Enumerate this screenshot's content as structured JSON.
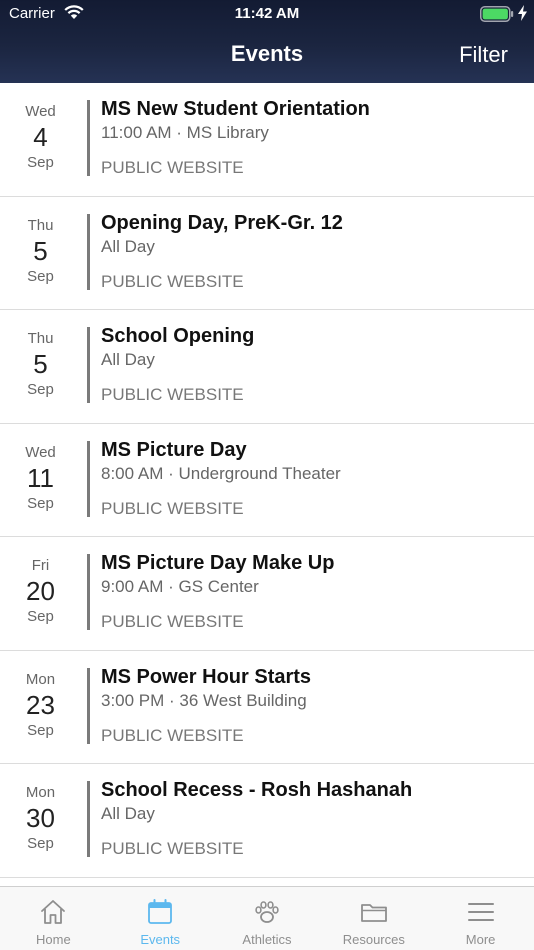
{
  "status_bar": {
    "carrier": "Carrier",
    "time": "11:42 AM"
  },
  "nav": {
    "title": "Events",
    "filter_label": "Filter"
  },
  "events": [
    {
      "dow": "Wed",
      "day": "4",
      "month": "Sep",
      "title": "MS New Student Orientation",
      "time": "11:00 AM · MS Library",
      "source": "PUBLIC WEBSITE"
    },
    {
      "dow": "Thu",
      "day": "5",
      "month": "Sep",
      "title": "Opening Day, PreK-Gr. 12",
      "time": "All Day",
      "source": "PUBLIC WEBSITE"
    },
    {
      "dow": "Thu",
      "day": "5",
      "month": "Sep",
      "title": "School Opening",
      "time": "All Day",
      "source": "PUBLIC WEBSITE"
    },
    {
      "dow": "Wed",
      "day": "11",
      "month": "Sep",
      "title": "MS Picture Day",
      "time": "8:00 AM · Underground Theater",
      "source": "PUBLIC WEBSITE"
    },
    {
      "dow": "Fri",
      "day": "20",
      "month": "Sep",
      "title": "MS Picture Day Make Up",
      "time": "9:00 AM · GS Center",
      "source": "PUBLIC WEBSITE"
    },
    {
      "dow": "Mon",
      "day": "23",
      "month": "Sep",
      "title": "MS Power Hour Starts",
      "time": "3:00 PM · 36 West Building",
      "source": "PUBLIC WEBSITE"
    },
    {
      "dow": "Mon",
      "day": "30",
      "month": "Sep",
      "title": "School Recess - Rosh Hashanah",
      "time": "All Day",
      "source": "PUBLIC WEBSITE"
    }
  ],
  "tabs": [
    {
      "label": "Home",
      "icon": "home-icon"
    },
    {
      "label": "Events",
      "icon": "calendar-icon"
    },
    {
      "label": "Athletics",
      "icon": "paw-icon"
    },
    {
      "label": "Resources",
      "icon": "folder-icon"
    },
    {
      "label": "More",
      "icon": "menu-icon"
    }
  ],
  "colors": {
    "header_top": "#131b33",
    "header_bottom": "#253254",
    "tab_active": "#5cb8ee",
    "tab_inactive": "#8e8e8e",
    "battery": "#4cd964"
  }
}
